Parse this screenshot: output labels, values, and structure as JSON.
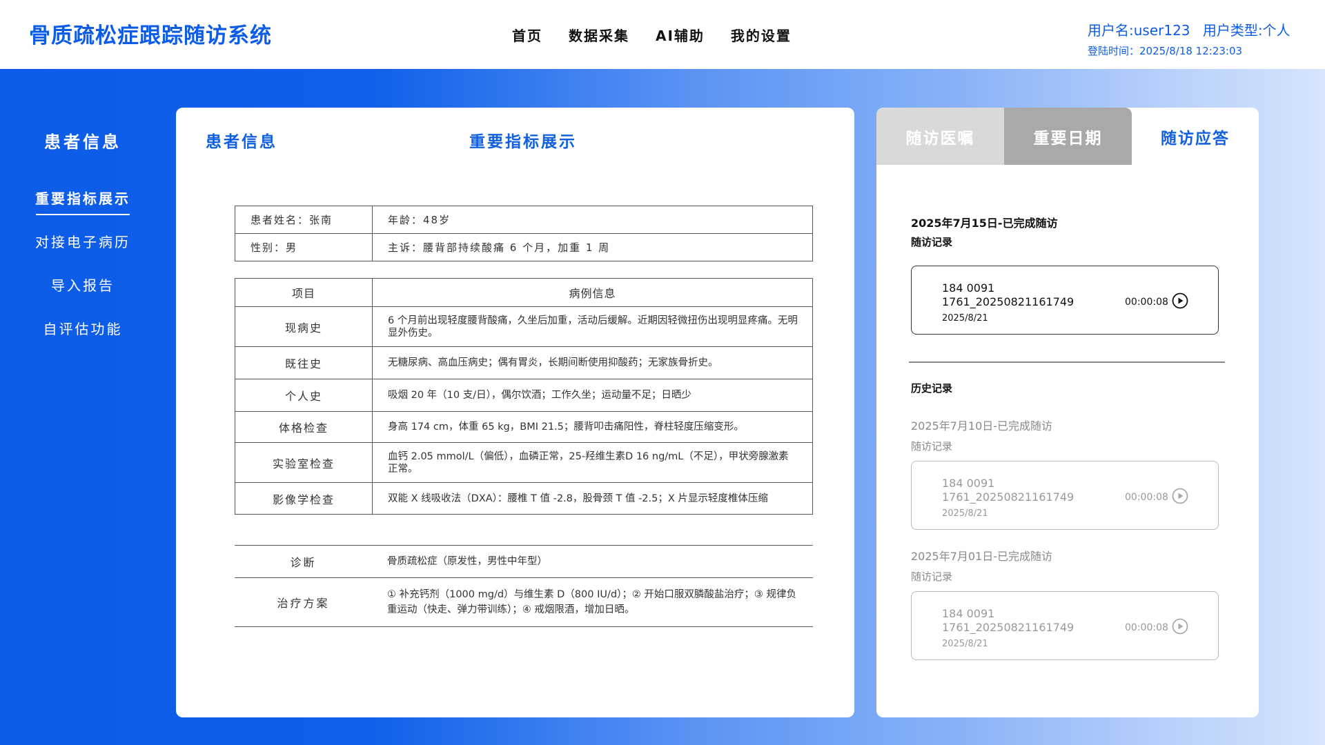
{
  "header": {
    "app_title": "骨质疏松症跟踪随访系统",
    "nav": [
      "首页",
      "数据采集",
      "AI辅助",
      "我的设置"
    ],
    "user_name_label": "用户名:user123",
    "user_type_label": "用户类型:个人",
    "login_time": "登陆时间：2025/8/18 12:23:03"
  },
  "sidebar": {
    "title": "患者信息",
    "items": [
      {
        "label": "重要指标展示",
        "active": true
      },
      {
        "label": "对接电子病历",
        "active": false
      },
      {
        "label": "导入报告",
        "active": false
      },
      {
        "label": "自评估功能",
        "active": false
      }
    ]
  },
  "main": {
    "heading_left": "患者信息",
    "heading_center": "重要指标展示",
    "patient": {
      "name": "患者姓名：张南",
      "age": "年龄：48岁",
      "gender": "性别：男",
      "complaint": "主诉：腰背部持续酸痛 6 个月，加重 1 周"
    },
    "record_table": {
      "col_item": "项目",
      "col_info": "病例信息",
      "rows": [
        {
          "item": "现病史",
          "info": "6 个月前出现轻度腰背酸痛，久坐后加重，活动后缓解。近期因轻微扭伤出现明显疼痛。无明显外伤史。"
        },
        {
          "item": "既往史",
          "info": "无糖尿病、高血压病史；偶有胃炎，长期间断使用抑酸药；无家族骨折史。"
        },
        {
          "item": "个人史",
          "info": "吸烟 20 年（10 支/日），偶尔饮酒；工作久坐；运动量不足；日晒少"
        },
        {
          "item": "体格检查",
          "info": "身高 174 cm，体重 65 kg，BMI 21.5；腰背叩击痛阳性，脊柱轻度压缩变形。"
        },
        {
          "item": "实验室检查",
          "info": "血钙 2.05 mmol/L（偏低），血磷正常，25-羟维生素D 16 ng/mL（不足），甲状旁腺激素正常。"
        },
        {
          "item": "影像学检查",
          "info": "双能 X 线吸收法（DXA）：腰椎 T 值 -2.8，股骨颈 T 值 -2.5；X 片显示轻度椎体压缩"
        }
      ]
    },
    "diagnosis": {
      "label": "诊断",
      "value": "骨质疏松症（原发性，男性中年型）"
    },
    "treatment": {
      "label": "治疗方案",
      "value": "① 补充钙剂（1000 mg/d）与维生素 D（800 IU/d）；② 开始口服双膦酸盐治疗；③ 规律负重运动（快走、弹力带训练）；④ 戒烟限酒，增加日晒。"
    }
  },
  "right_panel": {
    "tabs": [
      {
        "label": "随访医嘱",
        "active": false
      },
      {
        "label": "重要日期",
        "active": false
      },
      {
        "label": "随访应答",
        "active": true
      }
    ],
    "current": {
      "title": "2025年7月15日-已完成随访",
      "record_label": "随访记录",
      "recording": {
        "line1": "184 0091",
        "line2": "1761_20250821161749",
        "date": "2025/8/21",
        "duration": "00:00:08"
      }
    },
    "history_label": "历史记录",
    "history": [
      {
        "title": "2025年7月10日-已完成随访",
        "record_label": "随访记录",
        "recording": {
          "line1": "184 0091",
          "line2": "1761_20250821161749",
          "date": "2025/8/21",
          "duration": "00:00:08"
        }
      },
      {
        "title": "2025年7月01日-已完成随访",
        "record_label": "随访记录",
        "recording": {
          "line1": "184 0091",
          "line2": "1761_20250821161749",
          "date": "2025/8/21",
          "duration": "00:00:08"
        }
      }
    ],
    "colors": {
      "accent": "#1060e0",
      "tab_a": "#d9d9d9",
      "tab_b": "#a9a9a9"
    }
  }
}
